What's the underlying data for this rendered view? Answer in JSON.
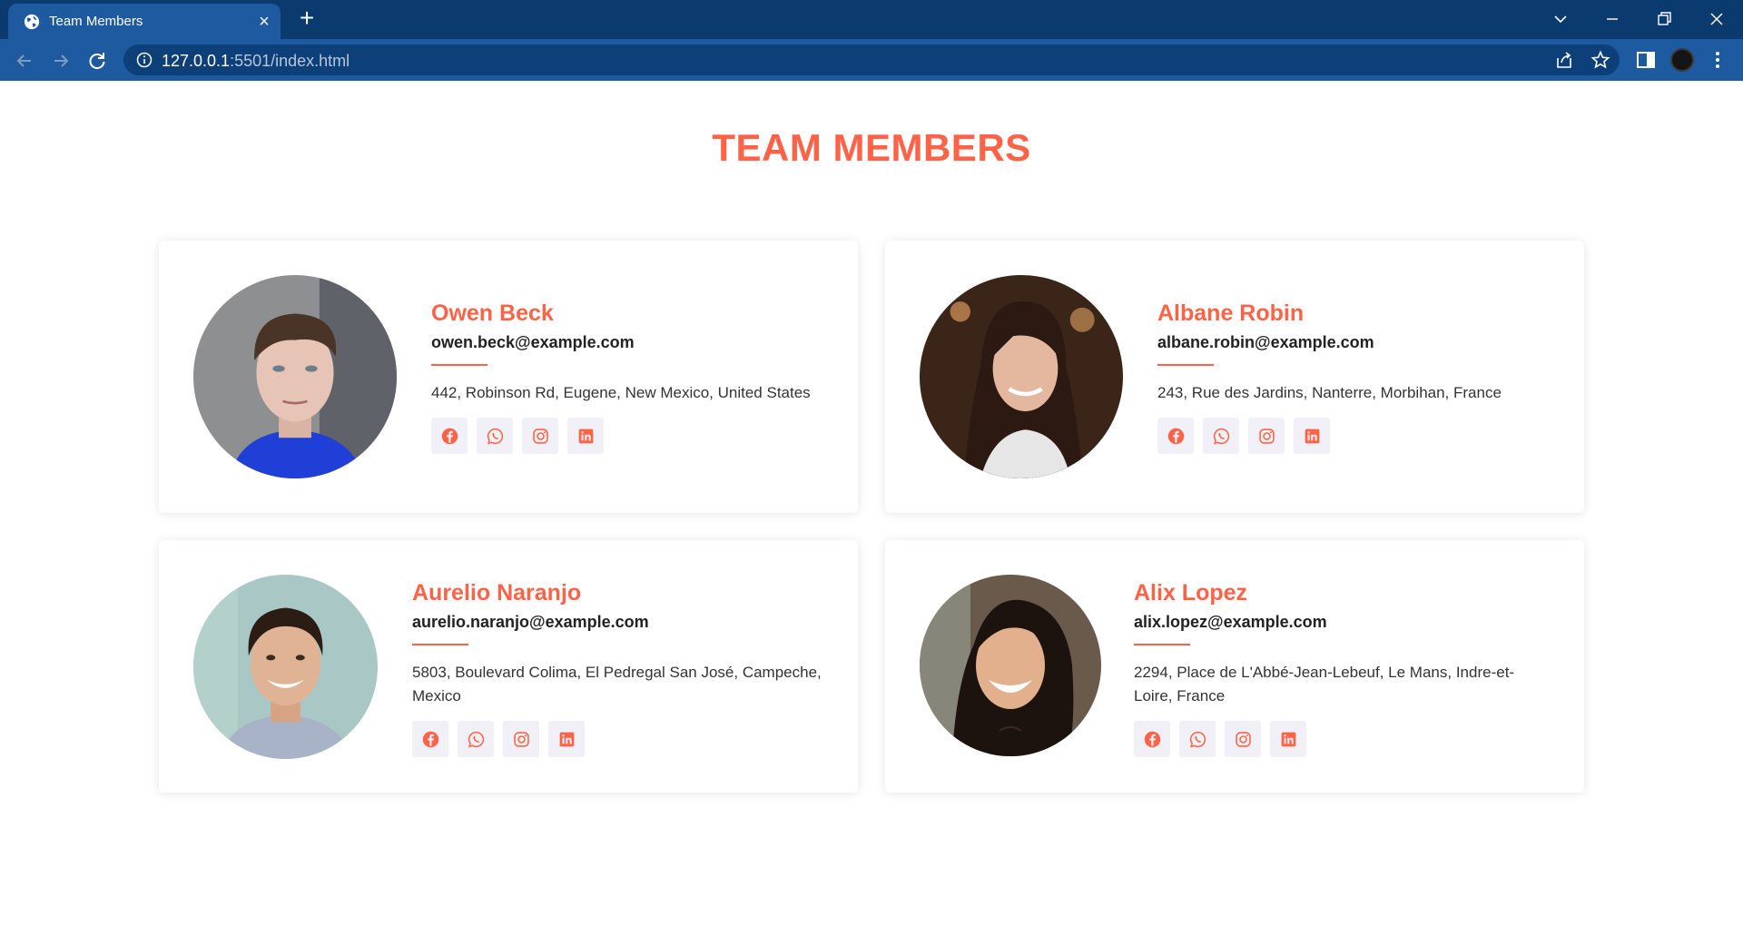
{
  "browser": {
    "tab_title": "Team Members",
    "url_host": "127.0.0.1",
    "url_rest": ":5501/index.html"
  },
  "page": {
    "title": "TEAM MEMBERS",
    "accent_color": "#ff6347"
  },
  "members": [
    {
      "name": "Owen Beck",
      "email": "owen.beck@example.com",
      "address": "442, Robinson Rd, Eugene, New Mexico, United States",
      "photo": "photo-young-man-blue-shirt",
      "socials": [
        "facebook-icon",
        "whatsapp-icon",
        "instagram-icon",
        "linkedin-icon"
      ]
    },
    {
      "name": "Albane Robin",
      "email": "albane.robin@example.com",
      "address": "243, Rue des Jardins, Nanterre, Morbihan, France",
      "photo": "photo-smiling-woman-long-hair",
      "socials": [
        "facebook-icon",
        "whatsapp-icon",
        "instagram-icon",
        "linkedin-icon"
      ]
    },
    {
      "name": "Aurelio Naranjo",
      "email": "aurelio.naranjo@example.com",
      "address": "5803, Boulevard Colima, El Pedregal San José, Campeche, Mexico",
      "photo": "photo-smiling-man-collared-shirt",
      "socials": [
        "facebook-icon",
        "whatsapp-icon",
        "instagram-icon",
        "linkedin-icon"
      ]
    },
    {
      "name": "Alix Lopez",
      "email": "alix.lopez@example.com",
      "address": "2294, Place de L'Abbé-Jean-Lebeuf, Le Mans, Indre-et-Loire, France",
      "photo": "photo-smiling-woman-dark-hair",
      "socials": [
        "facebook-icon",
        "whatsapp-icon",
        "instagram-icon",
        "linkedin-icon"
      ]
    }
  ]
}
